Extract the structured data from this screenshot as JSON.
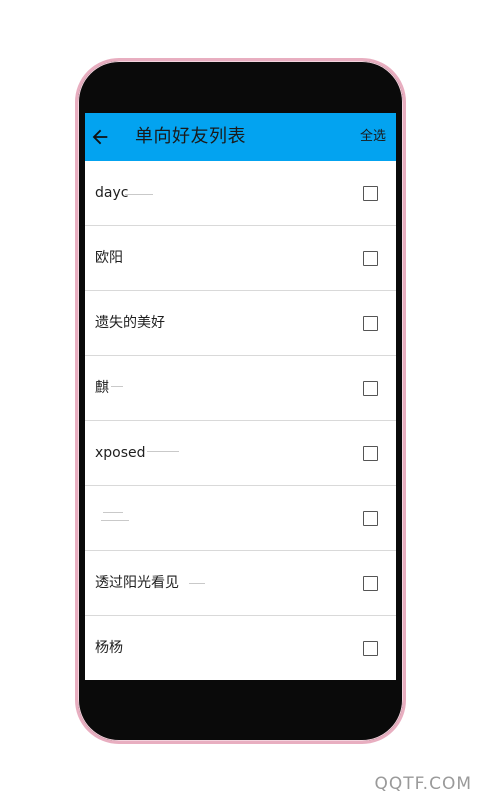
{
  "appbar": {
    "title": "单向好友列表",
    "select_all": "全选",
    "color": "#03a3f0"
  },
  "friends": [
    {
      "name": "dayc",
      "checked": false
    },
    {
      "name": "欧阳",
      "checked": false
    },
    {
      "name": "遗失的美好",
      "checked": false
    },
    {
      "name": "麒",
      "checked": false
    },
    {
      "name": "xposed",
      "checked": false
    },
    {
      "name": "",
      "checked": false
    },
    {
      "name": "透过阳光看见",
      "checked": false
    },
    {
      "name": "杨杨",
      "checked": false
    }
  ],
  "watermark": "QQTF.COM",
  "icons": {
    "back": "arrow-left-icon",
    "checkbox": "checkbox-unchecked-icon"
  }
}
